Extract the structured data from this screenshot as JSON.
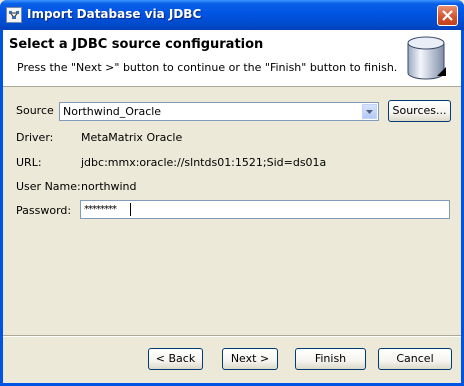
{
  "window": {
    "title": "Import Database via JDBC",
    "icon": "app-icon",
    "close_icon": "close-icon"
  },
  "header": {
    "title": "Select a JDBC source configuration",
    "description": "Press the \"Next >\" button to continue or the \"Finish\" button to finish.",
    "icon": "database-icon"
  },
  "form": {
    "source": {
      "label": "Source",
      "value": "Northwind_Oracle",
      "dropdown_icon": "chevron-down-icon"
    },
    "sources_button": "Sources...",
    "driver": {
      "label": "Driver:",
      "value": "MetaMatrix Oracle"
    },
    "url": {
      "label": "URL:",
      "value": "jdbc:mmx:oracle://slntds01:1521;Sid=ds01a"
    },
    "user": {
      "label": "User Name:",
      "value": "northwind"
    },
    "password": {
      "label": "Password:",
      "value": "********"
    }
  },
  "buttons": {
    "back": "< Back",
    "next": "Next >",
    "finish": "Finish",
    "cancel": "Cancel"
  }
}
